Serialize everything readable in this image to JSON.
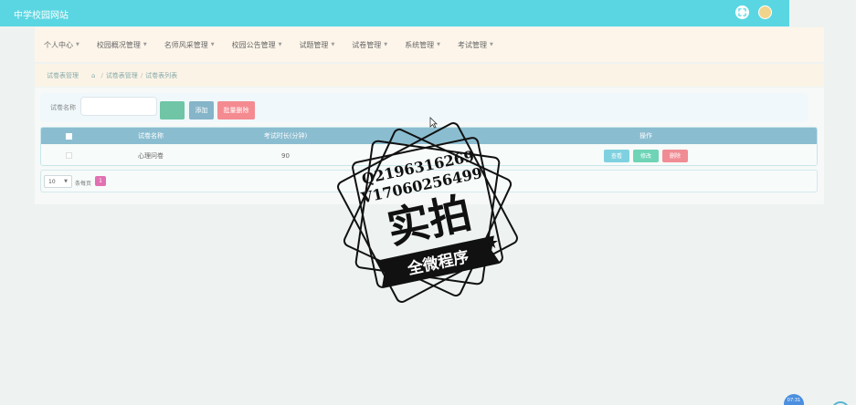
{
  "header": {
    "site_title": "中学校园网站"
  },
  "nav": {
    "items": [
      {
        "label": "个人中心"
      },
      {
        "label": "校园概况管理"
      },
      {
        "label": "名师风采管理"
      },
      {
        "label": "校园公告管理"
      },
      {
        "label": "试题管理"
      },
      {
        "label": "试卷管理"
      },
      {
        "label": "系统管理"
      },
      {
        "label": "考试管理"
      }
    ]
  },
  "breadcrumb": {
    "page_heading": "试卷表管理",
    "separator": "/",
    "crumb_1": "试卷表管理",
    "crumb_2": "试卷表列表"
  },
  "search": {
    "label": "试卷名称",
    "value": "",
    "add_label": "添加",
    "batch_delete_label": "批量删除"
  },
  "table": {
    "headers": {
      "name": "试卷名称",
      "duration": "考试时长(分钟)",
      "operations": "操作"
    },
    "rows": [
      {
        "name": "心理问卷",
        "duration": "90",
        "view_label": "查看",
        "edit_label": "修改",
        "delete_label": "删除"
      }
    ]
  },
  "pagination": {
    "page_size": "10",
    "per_page_label": "条每页",
    "current_page": "1"
  },
  "watermark": {
    "line1": "Q2196316269",
    "line2": "V17060256499",
    "main": "实拍",
    "ribbon": "全微程序"
  },
  "clock": {
    "time": "07:31"
  },
  "colors": {
    "topbar": "#5ad6e2",
    "navbar": "#fdf5ea",
    "table_header": "#8bbdd0",
    "search_button": "#6fc5a5",
    "add_button": "#86b4c8",
    "delete_button": "#f48b91",
    "view_button": "#7fd1e0",
    "edit_button": "#6fd4b5",
    "active_page": "#e271b2"
  }
}
